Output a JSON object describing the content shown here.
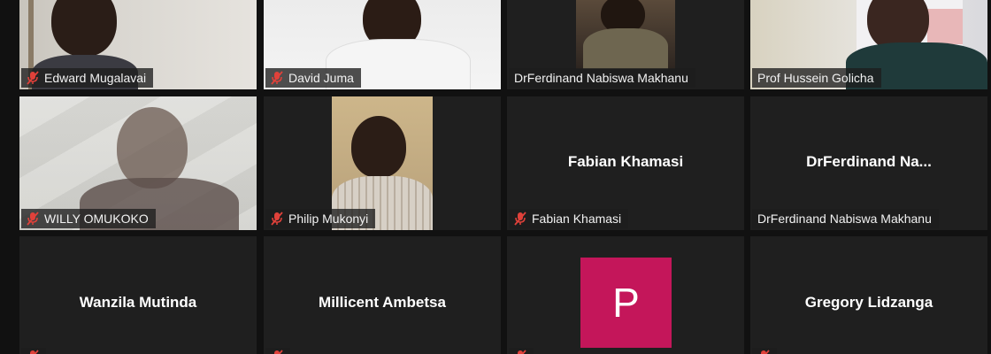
{
  "participants": [
    {
      "name": "Edward Mugalavai",
      "muted": true
    },
    {
      "name": "David Juma",
      "muted": true
    },
    {
      "name": "DrFerdinand Nabiswa Makhanu",
      "muted": false
    },
    {
      "name": "Prof Hussein Golicha",
      "muted": false
    },
    {
      "name": "WILLY OMUKOKO",
      "muted": true
    },
    {
      "name": "Philip Mukonyi",
      "muted": true
    },
    {
      "name": "Fabian Khamasi",
      "muted": true,
      "display_name": "Fabian Khamasi"
    },
    {
      "name": "DrFerdinand Nabiswa Makhanu",
      "muted": false,
      "display_name": "DrFerdinand  Na..."
    },
    {
      "display_name": "Wanzila Mutinda"
    },
    {
      "display_name": "Millicent Ambetsa"
    },
    {
      "avatar_letter": "P",
      "avatar_color": "#c4165a"
    },
    {
      "display_name": "Gregory Lidzanga"
    }
  ],
  "colors": {
    "background": "#111111",
    "tile": "#1f1f1f",
    "muted_icon": "#e0413a",
    "avatar": "#c4165a"
  },
  "icons": {
    "muted": "mic-off-icon"
  }
}
